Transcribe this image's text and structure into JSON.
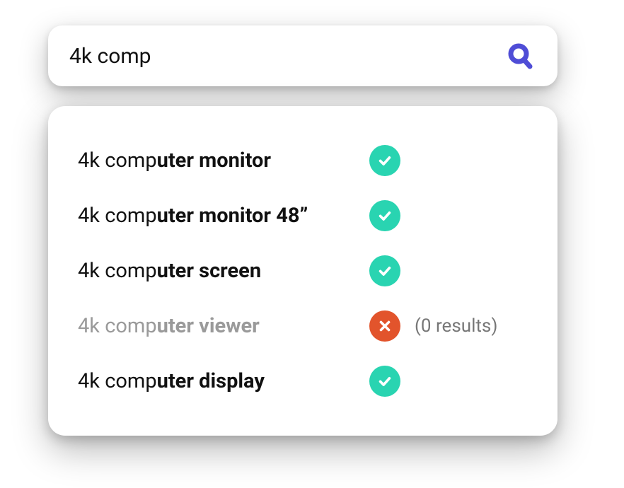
{
  "search": {
    "query": "4k comp",
    "placeholder": ""
  },
  "icons": {
    "search": "search-icon"
  },
  "colors": {
    "accent": "#4f4dd6",
    "success": "#29d4b1",
    "error": "#e2542c",
    "muted": "#9a9a9a"
  },
  "suggestions": [
    {
      "prefix": "4k comp",
      "completion": "uter monitor",
      "status": "ok",
      "note": ""
    },
    {
      "prefix": "4k comp",
      "completion": "uter monitor 48”",
      "status": "ok",
      "note": ""
    },
    {
      "prefix": "4k comp",
      "completion": "uter screen",
      "status": "ok",
      "note": ""
    },
    {
      "prefix": "4k comp",
      "completion": "uter viewer",
      "status": "bad",
      "note": "(0 results)"
    },
    {
      "prefix": "4k comp",
      "completion": "uter display",
      "status": "ok",
      "note": ""
    }
  ]
}
